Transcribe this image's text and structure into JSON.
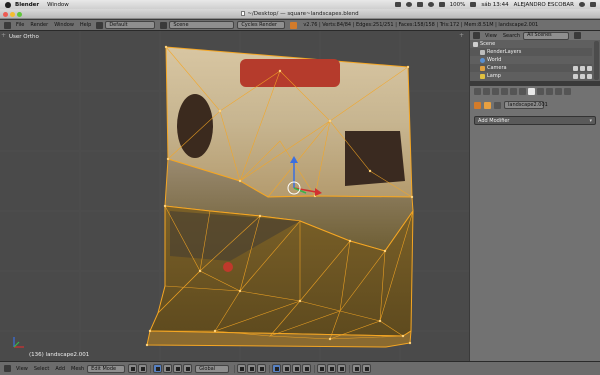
{
  "macbar": {
    "app": "Blender",
    "menus": [
      "Window"
    ],
    "battery": "100%",
    "clock": "sáb 13:44",
    "user": "ALEJANDRO ESCOBAR"
  },
  "titlebar": {
    "document": "~/Desktop/ — square~landscapes.blend"
  },
  "infoheader": {
    "menus": [
      "File",
      "Render",
      "Window",
      "Help"
    ],
    "layout": "Default",
    "scene": "Scene",
    "engine": "Cycles Render",
    "stats": "v2.76 | Verts:84/84 | Edges:251/251 | Faces:158/158 | Tris:172 | Mem:8.51M | landscape2.001"
  },
  "viewport": {
    "view_label": "User Ortho",
    "object_label": "(136) landscape2.001"
  },
  "outliner": {
    "view": "View",
    "search": "Search",
    "filter": "All Scenes",
    "items": [
      "Scene",
      "RenderLayers",
      "World",
      "Camera",
      "Lamp"
    ]
  },
  "properties": {
    "object_name": "landscape2.001",
    "add_modifier": "Add Modifier"
  },
  "bottomheader": {
    "menus": [
      "View",
      "Select",
      "Add",
      "Mesh"
    ],
    "mode": "Edit Mode",
    "orientation": "Global"
  },
  "colors": {
    "selection_orange": "#f5a623",
    "viewport_bg": "#4a4a4a",
    "header": "#6f6f6f"
  }
}
